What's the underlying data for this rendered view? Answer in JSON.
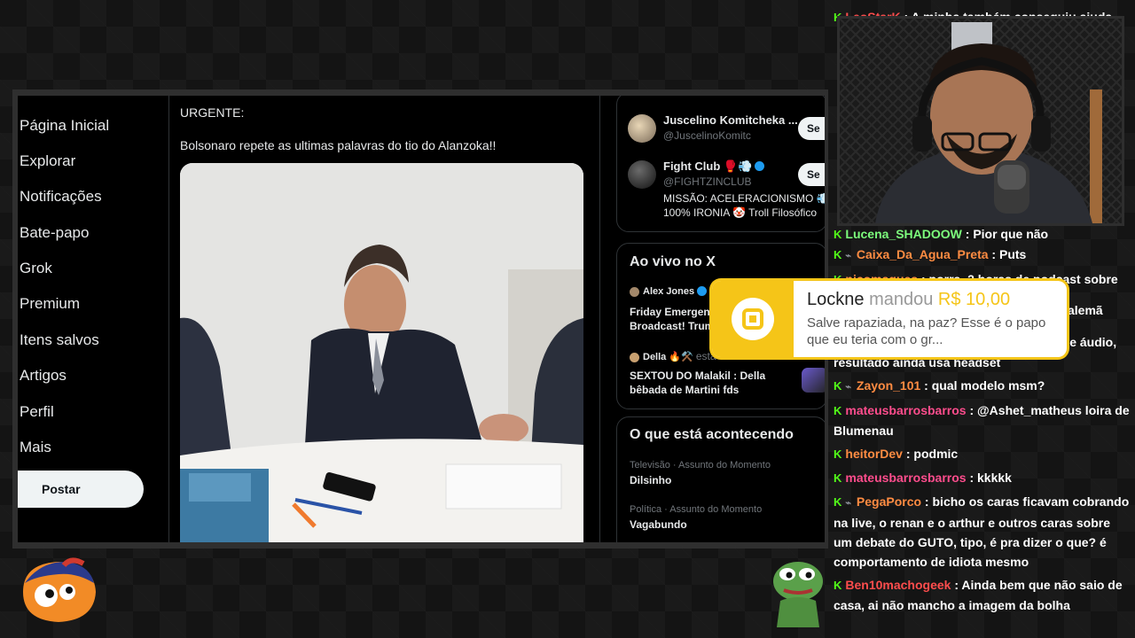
{
  "x": {
    "nav": {
      "items": [
        "Página Inicial",
        "Explorar",
        "Notificações",
        "Bate-papo",
        "Grok",
        "Premium",
        "Itens salvos",
        "Artigos",
        "Perfil",
        "Mais"
      ],
      "post_button": "Postar"
    },
    "post": {
      "line1": "URGENTE:",
      "line2": "Bolsonaro repete as ultimas palavras do tio do Alanzoka!!"
    },
    "follow_suggestions": [
      {
        "name": "Juscelino Komitcheka ...",
        "handle": "@JuscelinoKomitc",
        "button": "Se"
      },
      {
        "name": "Fight Club 🥊💨",
        "handle": "@FIGHTZINCLUB",
        "bio1": "MISSÃO: ACELERACIONISMO 💨",
        "bio2": "100% IRONIA 🤡 Troll Filosófico",
        "button": "Se"
      }
    ],
    "live": {
      "title": "Ao vivo no X",
      "items": [
        {
          "host": "Alex Jones",
          "text1": "Friday Emergenc",
          "text2": "Broadcast! Trum"
        },
        {
          "host": "Della 🔥⚒️",
          "host_suffix": "esta",
          "text1": "SEXTOU DO Malakil : Della",
          "text2": "bêbada de Martini fds"
        }
      ]
    },
    "trending": {
      "title": "O que está acontecendo",
      "items": [
        {
          "meta": "Televisão · Assunto do Momento",
          "topic": "Dilsinho"
        },
        {
          "meta": "Política · Assunto do Momento",
          "topic": "Vagabundo"
        }
      ]
    }
  },
  "donation": {
    "user": "Lockne",
    "verb": "mandou",
    "amount": "R$ 10,00",
    "message": "Salve rapaziada, na paz? Esse é o papo que eu teria com o gr..."
  },
  "chat_top": [
    {
      "user": "LeoStarK",
      "color": "#ff4d4d",
      "text": "A minha também conseguiu ajuda"
    }
  ],
  "chat": [
    {
      "user": "Lucena_SHADOOW",
      "color": "#7cfc7c",
      "text": "Pior que não",
      "sub": false
    },
    {
      "user": "Caixa_Da_Agua_Preta",
      "color": "#ff8c42",
      "text": "Puts",
      "sub": true
    },
    {
      "user": "nicomaques",
      "color": "#ff8c42",
      "text": "porra, 2 horas de podcast sobre",
      "sub": false
    },
    {
      "user": "",
      "color": "#ffffff",
      "text": "alemã",
      "sub": false
    },
    {
      "user": "heitorDev",
      "color": "#ff8c42",
      "text": "objetivo: usar monitores de áudio, resultado ainda usa headset",
      "sub": false
    },
    {
      "user": "Zayon_101",
      "color": "#ff8c42",
      "text": "qual modelo msm?",
      "sub": true
    },
    {
      "user": "mateusbarrosbarros",
      "color": "#ff4d8d",
      "text": "@Ashet_matheus loira de Blumenau",
      "sub": false
    },
    {
      "user": "heitorDev",
      "color": "#ff8c42",
      "text": "podmic",
      "sub": false
    },
    {
      "user": "mateusbarrosbarros",
      "color": "#ff4d8d",
      "text": "kkkkk",
      "sub": false
    },
    {
      "user": "PegaPorco",
      "color": "#ff8c42",
      "text": "bicho os caras ficavam cobrando na live, o renan e o arthur e outros caras sobre um debate do GUTO, tipo, é pra dizer o que? é comportamento de idiota mesmo",
      "sub": true
    },
    {
      "user": "Ben10machogeek",
      "color": "#ff4d4d",
      "text": "Ainda bem que não saio de casa, ai não mancho a imagem da bolha",
      "sub": false
    }
  ]
}
